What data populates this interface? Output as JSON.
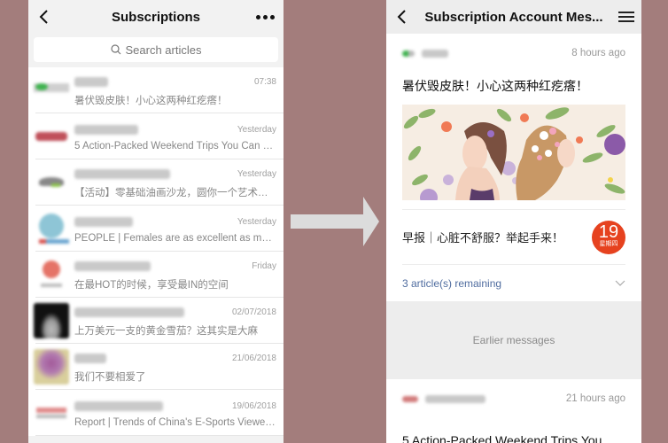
{
  "left": {
    "title": "Subscriptions",
    "search_placeholder": "Search articles",
    "items": [
      {
        "avatar": "green-logo-avatar",
        "time": "07:38",
        "preview": "暑伏毁皮肤！小心这两种红疙瘩！"
      },
      {
        "avatar": "red-logo-avatar",
        "time": "Yesterday",
        "preview": "5 Action-Packed Weekend Trips You Can B..."
      },
      {
        "avatar": "gray-logo-avatar",
        "time": "Yesterday",
        "preview": "【活动】零基础油画沙龙，圆你一个艺术梦..."
      },
      {
        "avatar": "blue-logo-avatar",
        "time": "Yesterday",
        "preview": "PEOPLE | Females are as excellent as males..."
      },
      {
        "avatar": "coral-logo-avatar",
        "time": "Friday",
        "preview": "在最HOT的时候，享受最IN的空间"
      },
      {
        "avatar": "dark-photo-avatar",
        "time": "02/07/2018",
        "preview": "上万美元一支的黄金雪茄？这其实是大麻"
      },
      {
        "avatar": "flower-photo-avatar",
        "time": "21/06/2018",
        "preview": "我们不要相爱了"
      },
      {
        "avatar": "china-logo-avatar",
        "time": "19/06/2018",
        "preview": "Report | Trends of China's E-Sports Viewer..."
      }
    ]
  },
  "right": {
    "title": "Subscription Account Mes...",
    "card1": {
      "time": "8 hours ago",
      "title": "暑伏毁皮肤！小心这两种红疙瘩！",
      "sub_article": "早报｜心脏不舒服？举起手来！",
      "day_num": "19",
      "day_week": "星期四",
      "remaining": "3 article(s) remaining"
    },
    "earlier": "Earlier messages",
    "card2": {
      "time": "21 hours ago",
      "title": "5 Action-Packed Weekend Trips You"
    }
  },
  "colors": {
    "background": "#a37d7c",
    "accent_red": "#e6421f",
    "link_blue": "#4f6c9f"
  }
}
